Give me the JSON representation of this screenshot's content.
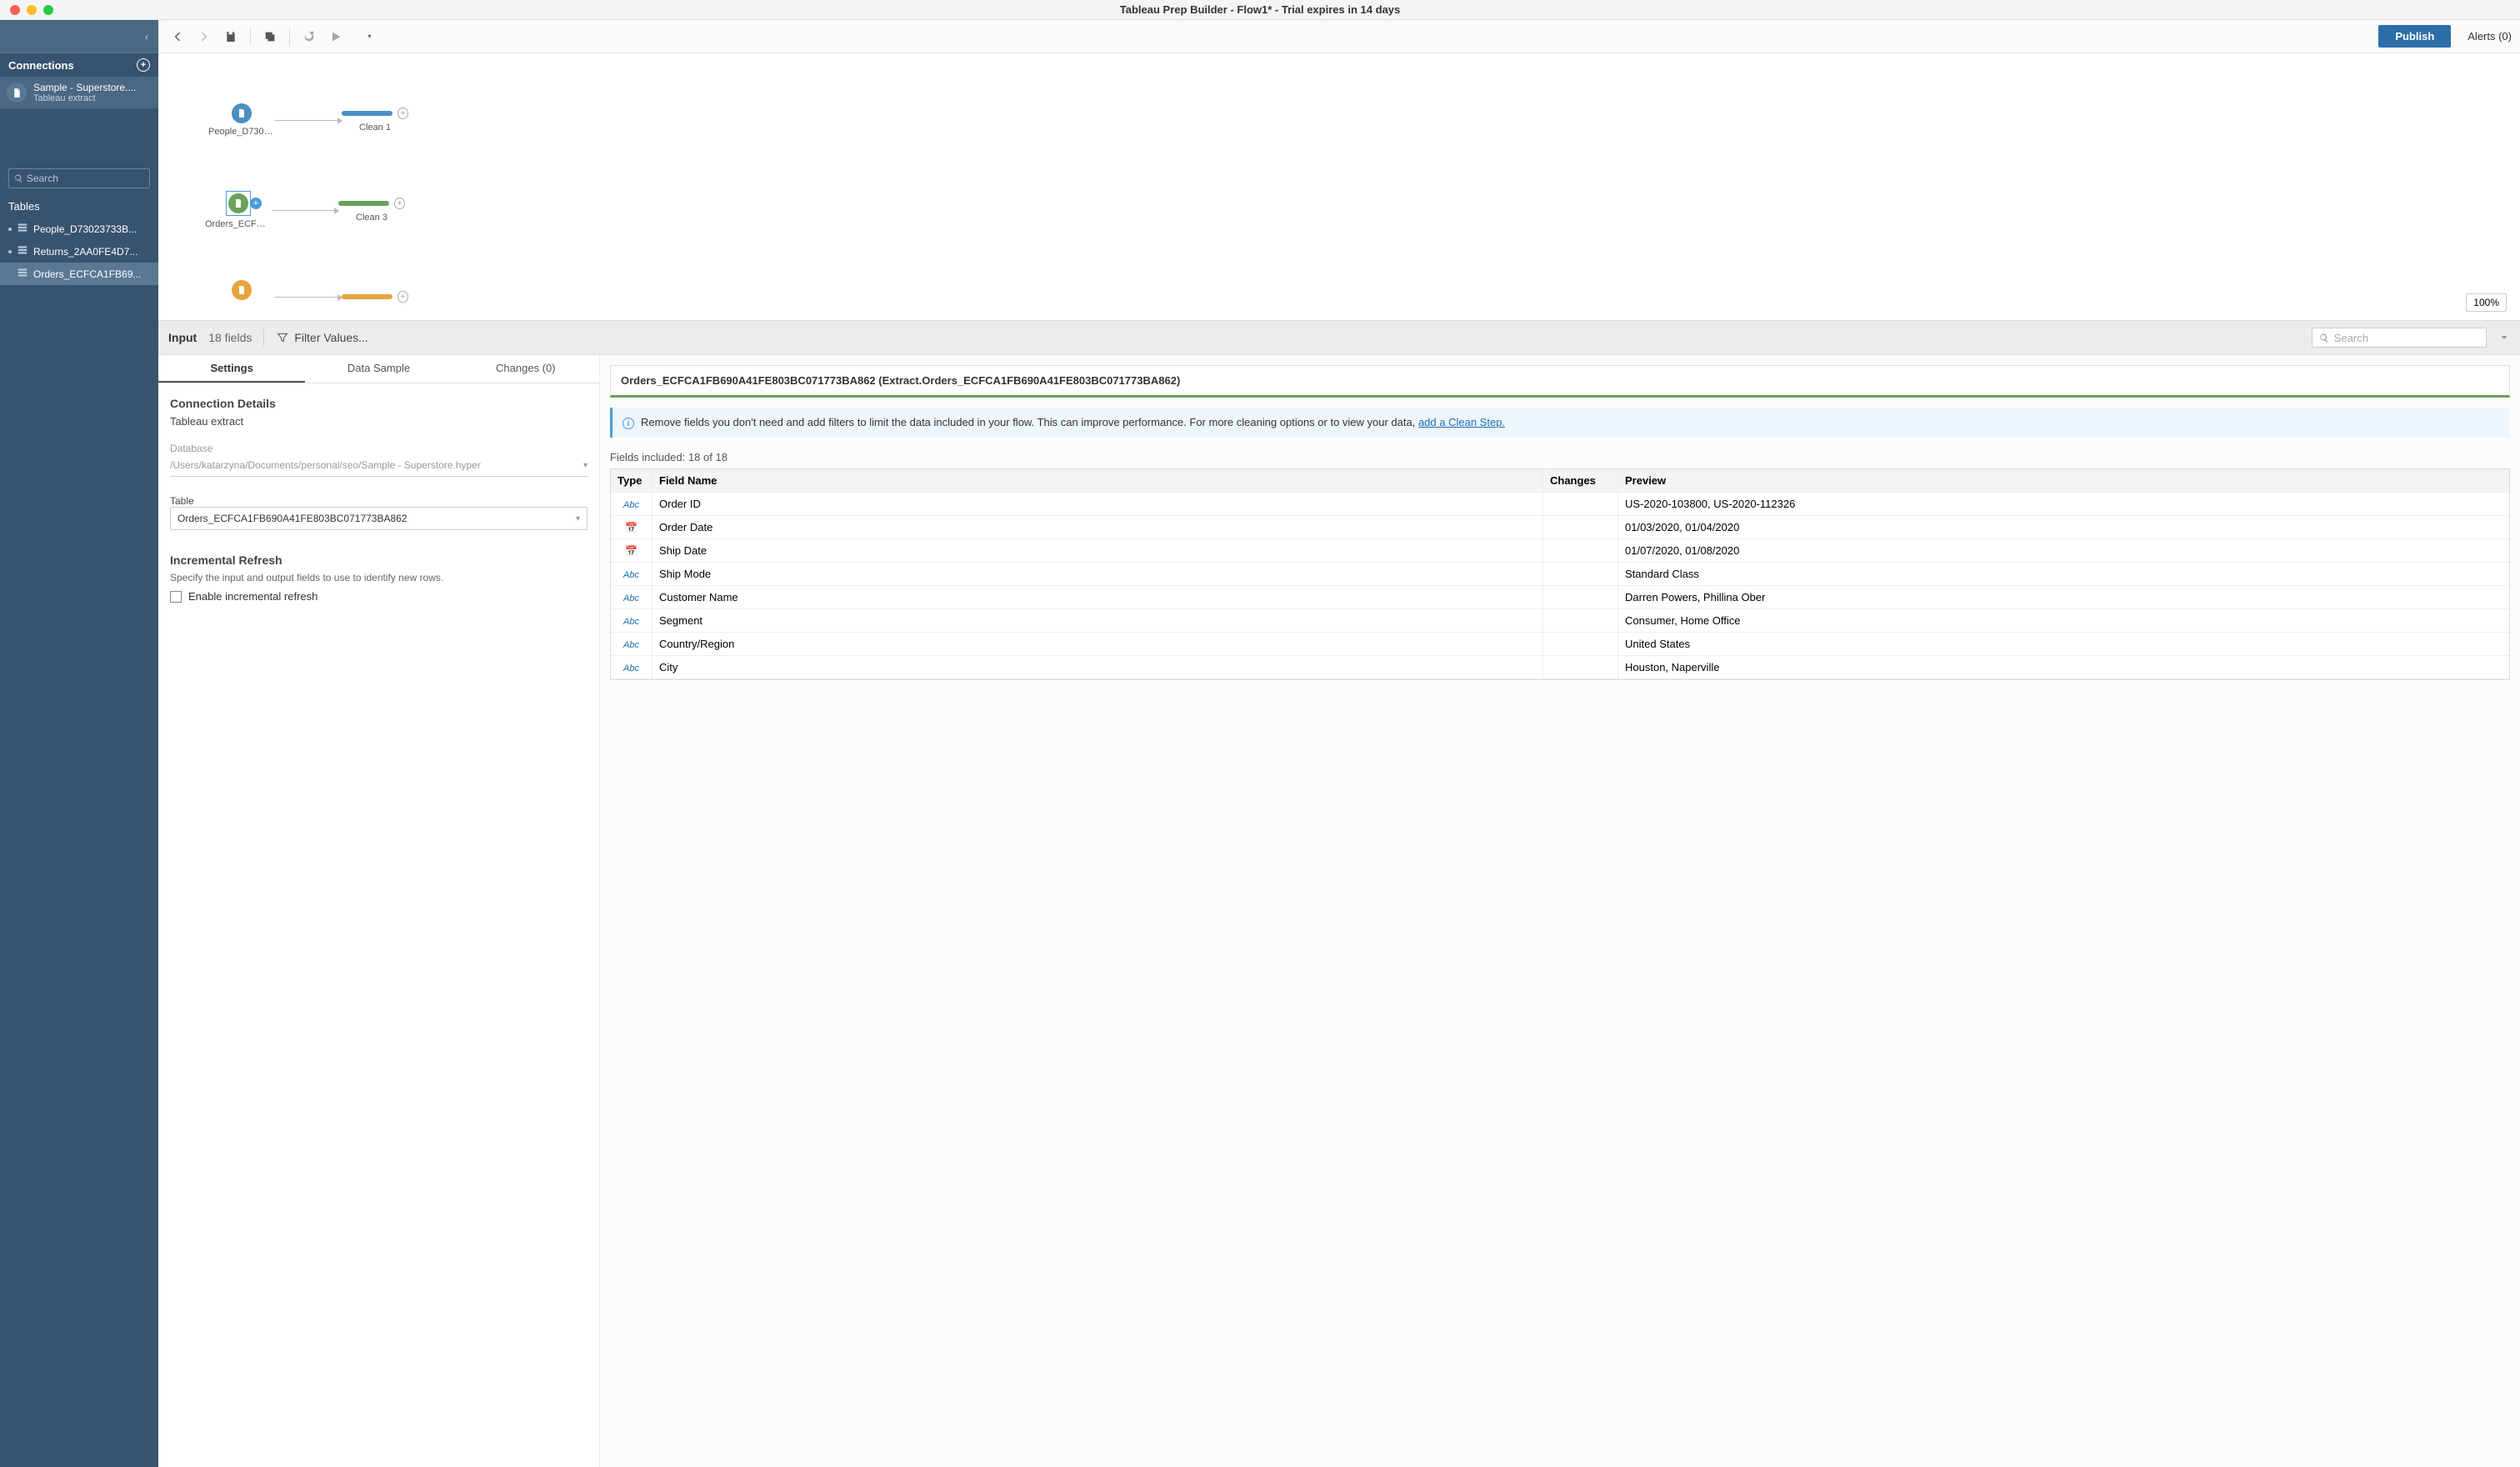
{
  "window": {
    "title": "Tableau Prep Builder - Flow1* - Trial expires in 14 days"
  },
  "sidebar": {
    "connections_label": "Connections",
    "connection": {
      "name": "Sample - Superstore....",
      "subtitle": "Tableau extract"
    },
    "search_placeholder": "Search",
    "tables_label": "Tables",
    "tables": [
      {
        "label": "People_D73023733B..."
      },
      {
        "label": "Returns_2AA0FE4D7..."
      },
      {
        "label": "Orders_ECFCA1FB69..."
      }
    ]
  },
  "toolbar": {
    "publish_label": "Publish",
    "alerts_label": "Alerts (0)"
  },
  "canvas": {
    "nodes": [
      {
        "input_label": "People_D7302...",
        "clean_label": "Clean 1",
        "color_input": "#4a90c2",
        "color_clean": "#4a90c2"
      },
      {
        "input_label": "Orders_ECFCA...",
        "clean_label": "Clean 3",
        "color_input": "#6aa35c",
        "color_clean": "#6aa35c",
        "selected": true
      },
      {
        "input_label": "",
        "clean_label": "",
        "color_input": "#e8a33d",
        "color_clean": "#e8a33d"
      }
    ],
    "zoom": "100%"
  },
  "panel_head": {
    "input_label": "Input",
    "fields_count": "18 fields",
    "filter_label": "Filter Values...",
    "search_placeholder": "Search"
  },
  "tabs": {
    "settings": "Settings",
    "data_sample": "Data Sample",
    "changes": "Changes (0)"
  },
  "settings_panel": {
    "conn_details_heading": "Connection Details",
    "conn_type": "Tableau extract",
    "database_label": "Database",
    "database_value": "/Users/katarzyna/Documents/personal/seo/Sample - Superstore.hyper",
    "table_label": "Table",
    "table_value": "Orders_ECFCA1FB690A41FE803BC071773BA862",
    "incremental_heading": "Incremental Refresh",
    "incremental_desc": "Specify the input and output fields to use to identify new rows.",
    "incremental_checkbox": "Enable incremental refresh"
  },
  "right_panel": {
    "table_full_name": "Orders_ECFCA1FB690A41FE803BC071773BA862 (Extract.Orders_ECFCA1FB690A41FE803BC071773BA862)",
    "info_text": "Remove fields you don't need and add filters to limit the data included in your flow. This can improve performance. For more cleaning options or to view your data, ",
    "info_link": "add a Clean Step.",
    "fields_included": "Fields included: 18 of 18",
    "columns": {
      "type": "Type",
      "name": "Field Name",
      "changes": "Changes",
      "preview": "Preview"
    },
    "fields": [
      {
        "type": "Abc",
        "name": "Order ID",
        "preview": "US-2020-103800, US-2020-112326"
      },
      {
        "type": "date",
        "name": "Order Date",
        "preview": "01/03/2020, 01/04/2020"
      },
      {
        "type": "date",
        "name": "Ship Date",
        "preview": "01/07/2020, 01/08/2020"
      },
      {
        "type": "Abc",
        "name": "Ship Mode",
        "preview": "Standard Class"
      },
      {
        "type": "Abc",
        "name": "Customer Name",
        "preview": "Darren Powers, Phillina Ober"
      },
      {
        "type": "Abc",
        "name": "Segment",
        "preview": "Consumer, Home Office"
      },
      {
        "type": "Abc",
        "name": "Country/Region",
        "preview": "United States"
      },
      {
        "type": "Abc",
        "name": "City",
        "preview": "Houston, Naperville"
      }
    ]
  }
}
